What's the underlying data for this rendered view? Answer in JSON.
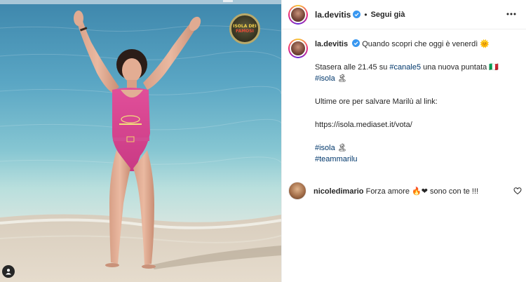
{
  "post": {
    "username": "la.devitis",
    "follow_label": "Segui già",
    "separator": "•",
    "logo_text": [
      "ISOLA DEI",
      "FAMOSI"
    ]
  },
  "caption": {
    "username": "la.devitis",
    "line1": "Quando scopri che oggi è venerdì",
    "line1_emoji": "🌞",
    "line2_prefix": "Stasera alle 21.45 su ",
    "line2_tag": "#canale5",
    "line2_mid": " una nuova puntata ",
    "line2_emoji": "🇮🇹",
    "line2_tag2": "#isola",
    "line2_emoji2": "🏝",
    "line3": "Ultime ore per salvare Marilù al link:",
    "line4": "https://isola.mediaset.it/vota/",
    "tag_isola": "#isola",
    "tag_isola_emoji": "🏝",
    "tag_team": "#teammarilu"
  },
  "comment": {
    "username": "nicoledimario",
    "text_before": "Forza amore ",
    "emojis": "🔥❤",
    "text_after": " sono con te !!!"
  },
  "colors": {
    "link": "#00376b",
    "verified": "#3897f0",
    "text": "#262626",
    "border": "#efefef"
  },
  "icons": [
    "verified-icon",
    "more-icon",
    "heart-icon",
    "user-tag-icon"
  ]
}
